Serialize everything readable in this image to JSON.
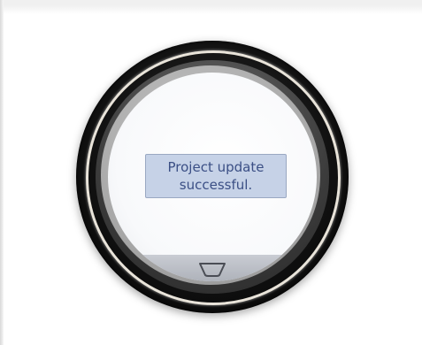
{
  "screen": {
    "message": {
      "line1": "Project update",
      "line2": "successful."
    },
    "bottom_button_icon": "back-key-icon"
  },
  "colors": {
    "message_bg": "#c6d2e7",
    "message_text": "#3b4f85",
    "bezel": "#111111",
    "ring": "#e9e4da"
  }
}
